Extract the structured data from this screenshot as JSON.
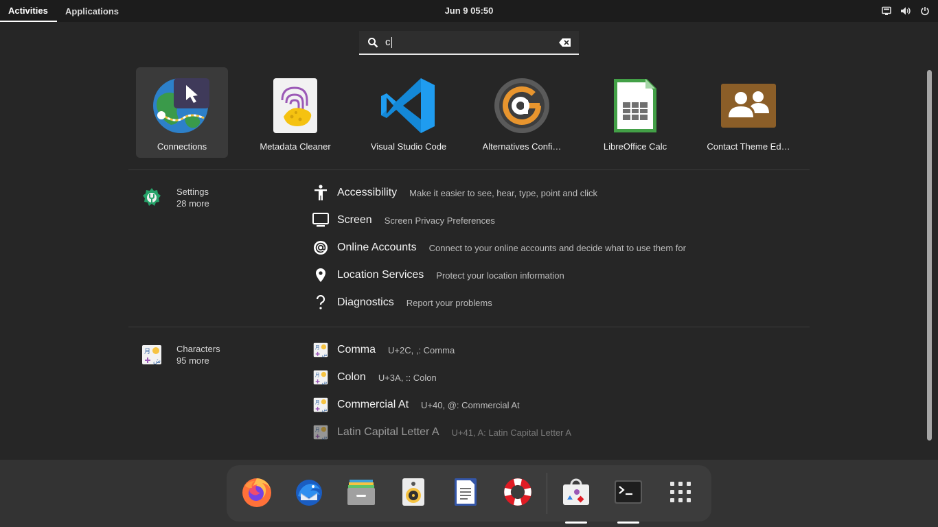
{
  "topbar": {
    "activities": "Activities",
    "applications": "Applications",
    "clock": "Jun 9  05:50",
    "status_icons": [
      "network-wired-icon",
      "volume-icon",
      "power-icon"
    ]
  },
  "search": {
    "value": "c"
  },
  "apps": [
    {
      "label": "Connections",
      "icon": "connections-icon"
    },
    {
      "label": "Metadata Cleaner",
      "icon": "metadata-cleaner-icon"
    },
    {
      "label": "Visual Studio Code",
      "icon": "vscode-icon"
    },
    {
      "label": "Alternatives Confi…",
      "icon": "alternatives-icon"
    },
    {
      "label": "LibreOffice Calc",
      "icon": "libreoffice-calc-icon"
    },
    {
      "label": "Contact Theme Ed…",
      "icon": "contact-theme-icon"
    }
  ],
  "settings_provider": {
    "name": "Settings",
    "more": "28 more",
    "results": [
      {
        "title": "Accessibility",
        "desc": "Make it easier to see, hear, type, point and click"
      },
      {
        "title": "Screen",
        "desc": "Screen Privacy Preferences"
      },
      {
        "title": "Online Accounts",
        "desc": "Connect to your online accounts and decide what to use them for"
      },
      {
        "title": "Location Services",
        "desc": "Protect your location information"
      },
      {
        "title": "Diagnostics",
        "desc": "Report your problems"
      }
    ]
  },
  "characters_provider": {
    "name": "Characters",
    "more": "95 more",
    "results": [
      {
        "title": "Comma",
        "desc": "U+2C, ,: Comma"
      },
      {
        "title": "Colon",
        "desc": "U+3A, :: Colon"
      },
      {
        "title": "Commercial At",
        "desc": "U+40, @: Commercial At"
      },
      {
        "title": "Latin Capital Letter A",
        "desc": "U+41, A: Latin Capital Letter A"
      }
    ]
  },
  "dash": {
    "items": [
      "firefox-icon",
      "thunderbird-icon",
      "files-icon",
      "rhythmbox-icon",
      "text-editor-icon",
      "help-icon",
      "software-icon",
      "terminal-icon",
      "show-apps-icon"
    ]
  },
  "colors": {
    "background": "#262626",
    "topbar": "#1c1c1c",
    "dash": "#3c3c3c"
  }
}
